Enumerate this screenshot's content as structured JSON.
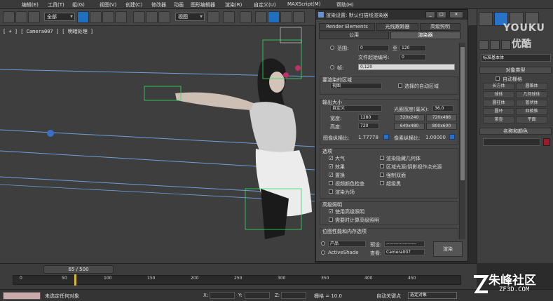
{
  "menu": [
    "编辑(E)",
    "工具(T)",
    "组(G)",
    "视图(V)",
    "创建(C)",
    "修改器",
    "动画",
    "图形编辑器",
    "渲染(R)",
    "自定义(U)",
    "MAXScript(M)",
    "帮助(H)"
  ],
  "toolbar": {
    "filter_value": "全部",
    "refcoord_value": "视图"
  },
  "viewport": {
    "label": "[ + ] [ Camera007 ] [ 明暗处理 ]"
  },
  "dialog": {
    "title": "渲染设置: 默认扫描线渲染器",
    "tabs_row1": [
      "Render Elements",
      "光线跟踪器",
      "高级照明"
    ],
    "tabs_row2": [
      "公用",
      "渲染器"
    ],
    "range": {
      "from_label": "范围:",
      "from_value": "0",
      "to_label": "至",
      "to_value": "120",
      "file_num_label": "文件起始编号:",
      "file_num_value": "0",
      "frames_label": "帧:",
      "frames_value": "0,120"
    },
    "area": {
      "title": "要渲染的区域",
      "select_value": "视图",
      "auto_region_label": "选择的自动区域"
    },
    "output": {
      "title": "输出大小",
      "preset_value": "自定义",
      "aperture_label": "光圈宽度(毫米):",
      "aperture_value": "36.0",
      "width_label": "宽度:",
      "width_value": "1280",
      "height_label": "高度:",
      "height_value": "720",
      "presets": [
        "320x240",
        "720x486",
        "640x480",
        "800x600"
      ],
      "image_aspect_label": "图像纵横比:",
      "image_aspect_value": "1.77778",
      "pixel_aspect_label": "像素纵横比:",
      "pixel_aspect_value": "1.00000"
    },
    "options": {
      "title": "选项",
      "items": [
        {
          "label": "大气",
          "checked": true
        },
        {
          "label": "渲染隐藏几何体",
          "checked": false
        },
        {
          "label": "效果",
          "checked": true
        },
        {
          "label": "区域光源/阴影视作点光源",
          "checked": false
        },
        {
          "label": "置换",
          "checked": true
        },
        {
          "label": "强制双面",
          "checked": false
        },
        {
          "label": "视频颜色检查",
          "checked": false
        },
        {
          "label": "超级黑",
          "checked": false
        },
        {
          "label": "渲染为场",
          "checked": false
        }
      ]
    },
    "adv_lighting": {
      "title": "高级照明",
      "use_label": "使用高级照明",
      "use_checked": true,
      "compute_label": "需要时计算高级照明",
      "compute_checked": false
    },
    "bitmap_title": "位图性能和内存选项",
    "bottom": {
      "product_value": "产品",
      "preset_label": "预设:",
      "preset_value": "--------------------",
      "activeshade_label": "ActiveShade",
      "view_label": "查看:",
      "view_value": "Camera007",
      "render_label": "渲染"
    }
  },
  "cmdpanel": {
    "category_value": "标准基本体",
    "object_type_title": "对象类型",
    "autogrid_label": "自动栅格",
    "buttons": [
      "长方体",
      "圆锥体",
      "球体",
      "几何球体",
      "圆柱体",
      "管状体",
      "圆环",
      "四棱锥",
      "茶壶",
      "平面"
    ],
    "name_color_title": "名称和颜色"
  },
  "timeline": {
    "slider_text": "65 / 500",
    "ticks": [
      "0",
      "50",
      "100",
      "150",
      "200",
      "250",
      "300",
      "350",
      "400",
      "450"
    ]
  },
  "statusbar": {
    "status_text": "未选定任何对象",
    "x_label": "X:",
    "y_label": "Y:",
    "z_label": "Z:",
    "grid_text": "栅格 = 10.0",
    "autokey_text": "自动关键点",
    "selset_value": "选定对象"
  },
  "watermark": {
    "youku": "YOUKU",
    "youku_sub": "优酷",
    "site_title": "朱峰社区",
    "site_sub": "ZF3D.COM"
  },
  "colors": {
    "accent": "#2a72c8",
    "name_color_swatch": "#9a1c2c"
  }
}
